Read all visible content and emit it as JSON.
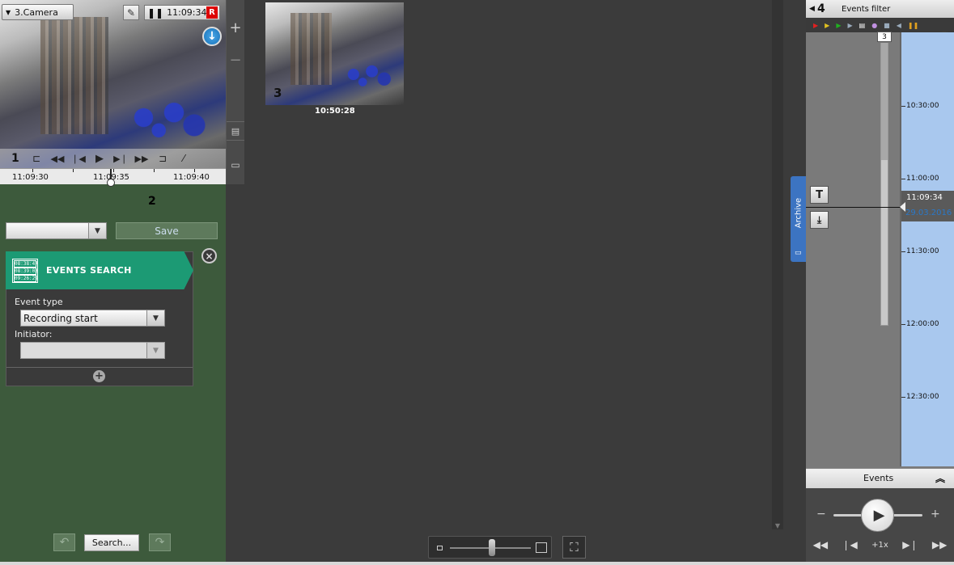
{
  "viewer": {
    "camera_label": "3.Camera",
    "time": "11:09:34",
    "rec_badge": "R",
    "tile_number": "1",
    "timeline_ticks": [
      "11:09:30",
      "11:09:35",
      "11:09:40"
    ]
  },
  "callout_numbers": {
    "two": "2",
    "four": "4"
  },
  "save_row": {
    "save_label": "Save"
  },
  "events_search": {
    "title": "EVENTS SEARCH",
    "icon_lines": [
      "08:38:47",
      "08:39:03",
      "09:26:29"
    ],
    "event_type_label": "Event type",
    "event_type_value": "Recording start",
    "initiator_label": "Initiator:",
    "initiator_value": ""
  },
  "bottom_bar": {
    "search_label": "Search..."
  },
  "thumbnail": {
    "number": "3",
    "time": "10:50:28"
  },
  "archive_tab": {
    "label": "Archive"
  },
  "right_panel": {
    "header_title": "Events filter",
    "filter_icons": [
      {
        "name": "red-triangle-icon",
        "color": "#e02020"
      },
      {
        "name": "yellow-triangle-icon",
        "color": "#e0c020"
      },
      {
        "name": "green-triangle-icon",
        "color": "#20b020"
      },
      {
        "name": "blue-triangle-icon",
        "color": "#9ab"
      },
      {
        "name": "document-icon",
        "color": "#fff"
      },
      {
        "name": "person-icon",
        "color": "#c090e0"
      },
      {
        "name": "video-camera-icon",
        "color": "#9ab"
      },
      {
        "name": "speaker-icon",
        "color": "#9ab"
      },
      {
        "name": "pause-filter-icon",
        "color": "#e0a020"
      }
    ],
    "slider_count": "3",
    "timeline": {
      "times": [
        "10:30:00",
        "11:00:00",
        "11:30:00",
        "12:00:00",
        "12:30:00"
      ],
      "current_time": "11:09:34",
      "current_date": "29.03.2016"
    },
    "events_title": "Events",
    "playback_speed": "+1x"
  },
  "colors": {
    "panel_green": "#3d5a3c",
    "events_teal": "#1c9a74",
    "timeline_blue": "#a9c8ee",
    "date_blue": "#2a78c8"
  }
}
